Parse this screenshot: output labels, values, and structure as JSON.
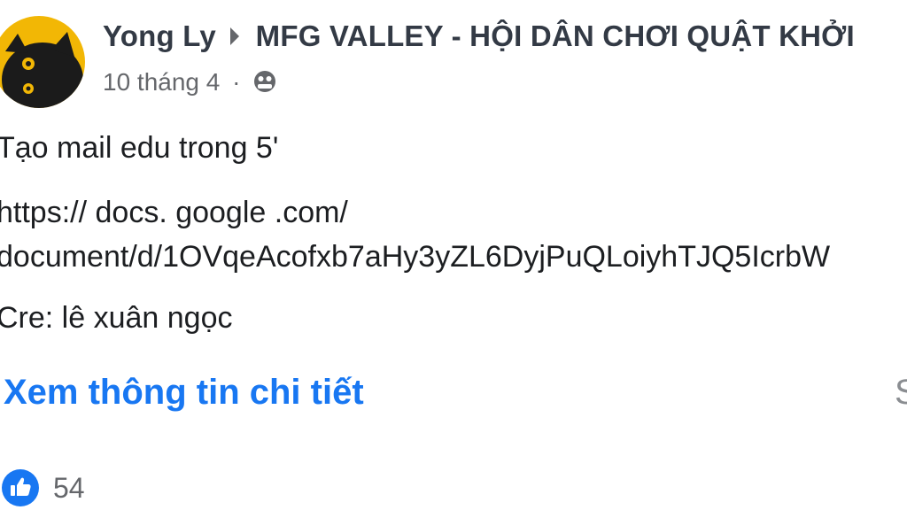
{
  "post": {
    "author": "Yong Ly",
    "group": "MFG VALLEY - HỘI DÂN CHƠI QUẬT KHỞI",
    "date": "10 tháng 4",
    "separator_dot": "·",
    "privacy_icon": "globe-icon",
    "lines": [
      "Tạo mail edu trong 5'",
      "https:// docs. google .com/",
      "document/d/1OVqeAcofxb7aHy3yZL6DyjPuQLoiyhTJQ5IcrbW",
      "Cre: lê xuân ngọc"
    ],
    "see_more": "Xem thông tin chi tiết",
    "right_partial": "S",
    "reactions": {
      "icon": "like-icon",
      "count": "54"
    }
  },
  "colors": {
    "link_blue": "#1877f2",
    "avatar_yellow": "#f2b705",
    "meta_gray": "#65676b"
  }
}
